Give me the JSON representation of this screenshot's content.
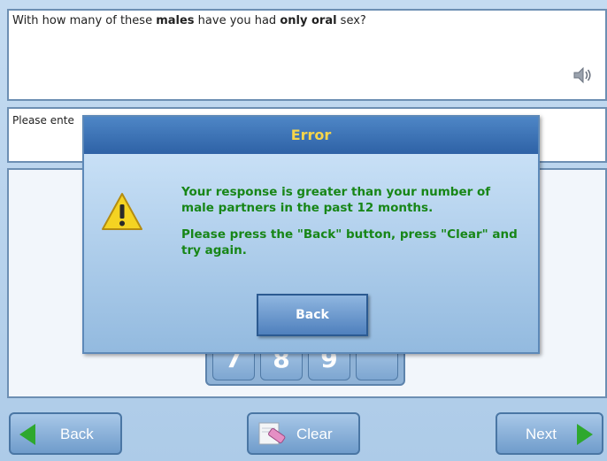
{
  "question": {
    "prefix": "With how many of these ",
    "males": "males",
    "middle": " have you had ",
    "only_oral": "only oral",
    "suffix": " sex?"
  },
  "instruction": {
    "visible_text": "Please ente"
  },
  "keypad": {
    "keys": [
      "7",
      "8",
      "9",
      ""
    ]
  },
  "nav": {
    "back_label": "Back",
    "clear_label": "Clear",
    "next_label": "Next"
  },
  "modal": {
    "title": "Error",
    "line1": "Your response is greater than your number of male partners in the past 12 months.",
    "line2": "Please press the \"Back\" button, press \"Clear\" and try again.",
    "back_label": "Back"
  },
  "icons": {
    "speaker": "speaker-icon",
    "warning": "warning-icon",
    "eraser": "eraser-icon",
    "back_arrow": "triangle-left-icon",
    "next_arrow": "triangle-right-icon"
  },
  "colors": {
    "accent_green": "#2ea82e",
    "modal_text": "#178617",
    "modal_title": "#f6d54a",
    "title_bar": "#2e62a6"
  }
}
